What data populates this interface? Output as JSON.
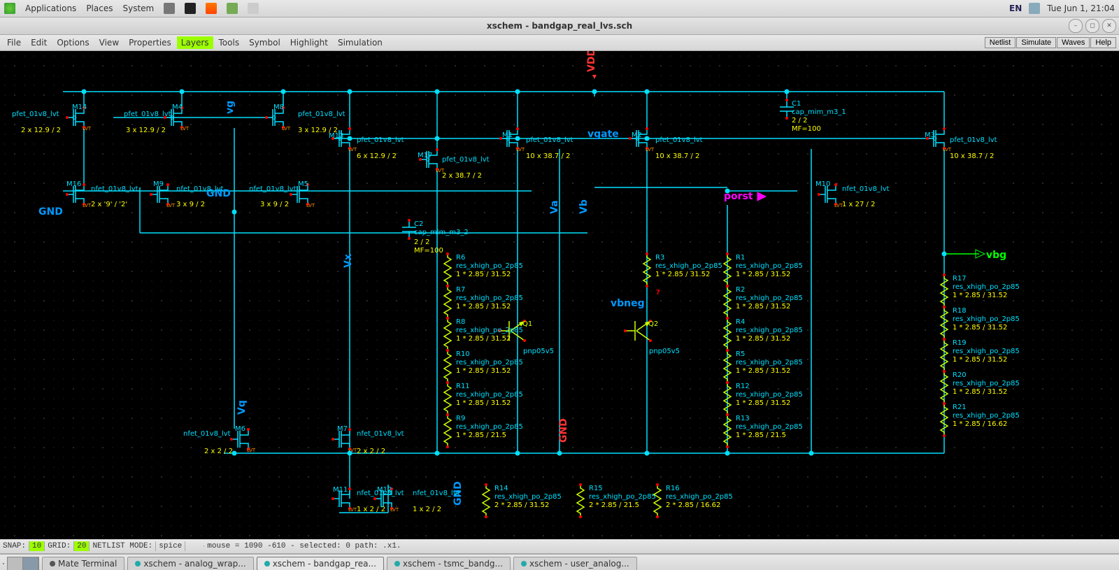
{
  "os_panel": {
    "apps": "Applications",
    "places": "Places",
    "system": "System",
    "lang": "EN",
    "clock": "Tue Jun  1, 21:04"
  },
  "window": {
    "title": "xschem - bandgap_real_lvs.sch"
  },
  "menu": {
    "file": "File",
    "edit": "Edit",
    "options": "Options",
    "view": "View",
    "properties": "Properties",
    "layers": "Layers",
    "tools": "Tools",
    "symbol": "Symbol",
    "highlight": "Highlight",
    "simulation": "Simulation",
    "netlist": "Netlist",
    "simulate": "Simulate",
    "waves": "Waves",
    "help": "Help"
  },
  "status": {
    "snap_lbl": "SNAP:",
    "snap": "10",
    "grid_lbl": "GRID:",
    "grid": "20",
    "mode_lbl": "NETLIST MODE:",
    "mode": "spice",
    "coords": "mouse = 1090 -610 - selected: 0 path: .x1."
  },
  "tasks": {
    "t0": "Mate Terminal",
    "t1": "xschem - analog_wrap...",
    "t2": "xschem - bandgap_rea...",
    "t3": "xschem - tsmc_bandg...",
    "t4": "xschem - user_analog..."
  },
  "nets": {
    "vdd": "VDD",
    "gnd": "GND",
    "gnd2": "GND",
    "gnd3": "GND",
    "gnd4": "GND",
    "vg": "vg",
    "vgate": "vgate",
    "va": "Va",
    "vb": "Vb",
    "vx": "Vx",
    "vq": "Vq",
    "vbneg": "vbneg",
    "porst": "porst",
    "vbg": "vbg",
    "qmark": "?"
  },
  "mos": {
    "pfet": "pfet_01v8_lvt",
    "nfet": "nfet_01v8_lvt",
    "pnp": "pnp05v5",
    "M14": "M14",
    "M14d": "2 x 12.9 / 2",
    "M4": "M4",
    "M4d": "3 x 12.9 / 2",
    "M8": "M8",
    "M8d": "3 x 12.9 / 2",
    "M13": "M13",
    "M13d": "6 x 12.9 / 2",
    "M17": "M17",
    "M17d": "2 x 38.7 / 2",
    "M1": "M1",
    "M1d": "10 x 38.7 / 2",
    "M2": "M2",
    "M2d": "10 x 38.7 / 2",
    "M3": "M3",
    "M3d": "10 x 38.7 / 2",
    "M16": "M16",
    "M16d": "2 x '9' / '2'",
    "M9": "M9",
    "M9d": "3 x 9 / 2",
    "M5": "M5",
    "M5d": "3 x 9 / 2",
    "M10": "M10",
    "M10d": "1 x 27 / 2",
    "M6": "M6",
    "M6d": "2 x 2 / 2",
    "M7": "M7",
    "M7d": "2 x 2 / 2",
    "M11": "M11",
    "M11d": "1 x 2 / 2",
    "M12": "M12",
    "M12d": "1 x 2 / 2",
    "Q1": "Q1",
    "Q2": "Q2"
  },
  "caps": {
    "C1": "C1",
    "C1t": "cap_mim_m3_1",
    "C1d1": "2 / 2",
    "C1d2": "MF=100",
    "C2": "C2",
    "C2t": "cap_mim_m3_2",
    "C2d1": "2 / 2",
    "C2d2": "MF=100"
  },
  "res": {
    "xhigh": "res_xhigh_po_2p85",
    "d1": "1 * 2.85 / 31.52",
    "d2": "1 * 2.85 / 21.5",
    "d3": "1 * 2.85 / 16.62",
    "d4": "2 * 2.85 / 31.52",
    "d5": "2 * 2.85 / 21.5",
    "d6": "2 * 2.85 / 16.62",
    "R1": "R1",
    "R2": "R2",
    "R3": "R3",
    "R4": "R4",
    "R5": "R5",
    "R6": "R6",
    "R7": "R7",
    "R8": "R8",
    "R9": "R9",
    "R10": "R10",
    "R11": "R11",
    "R12": "R12",
    "R13": "R13",
    "R14": "R14",
    "R15": "R15",
    "R16": "R16",
    "R17": "R17",
    "R18": "R18",
    "R19": "R19",
    "R20": "R20",
    "R21": "R21"
  }
}
